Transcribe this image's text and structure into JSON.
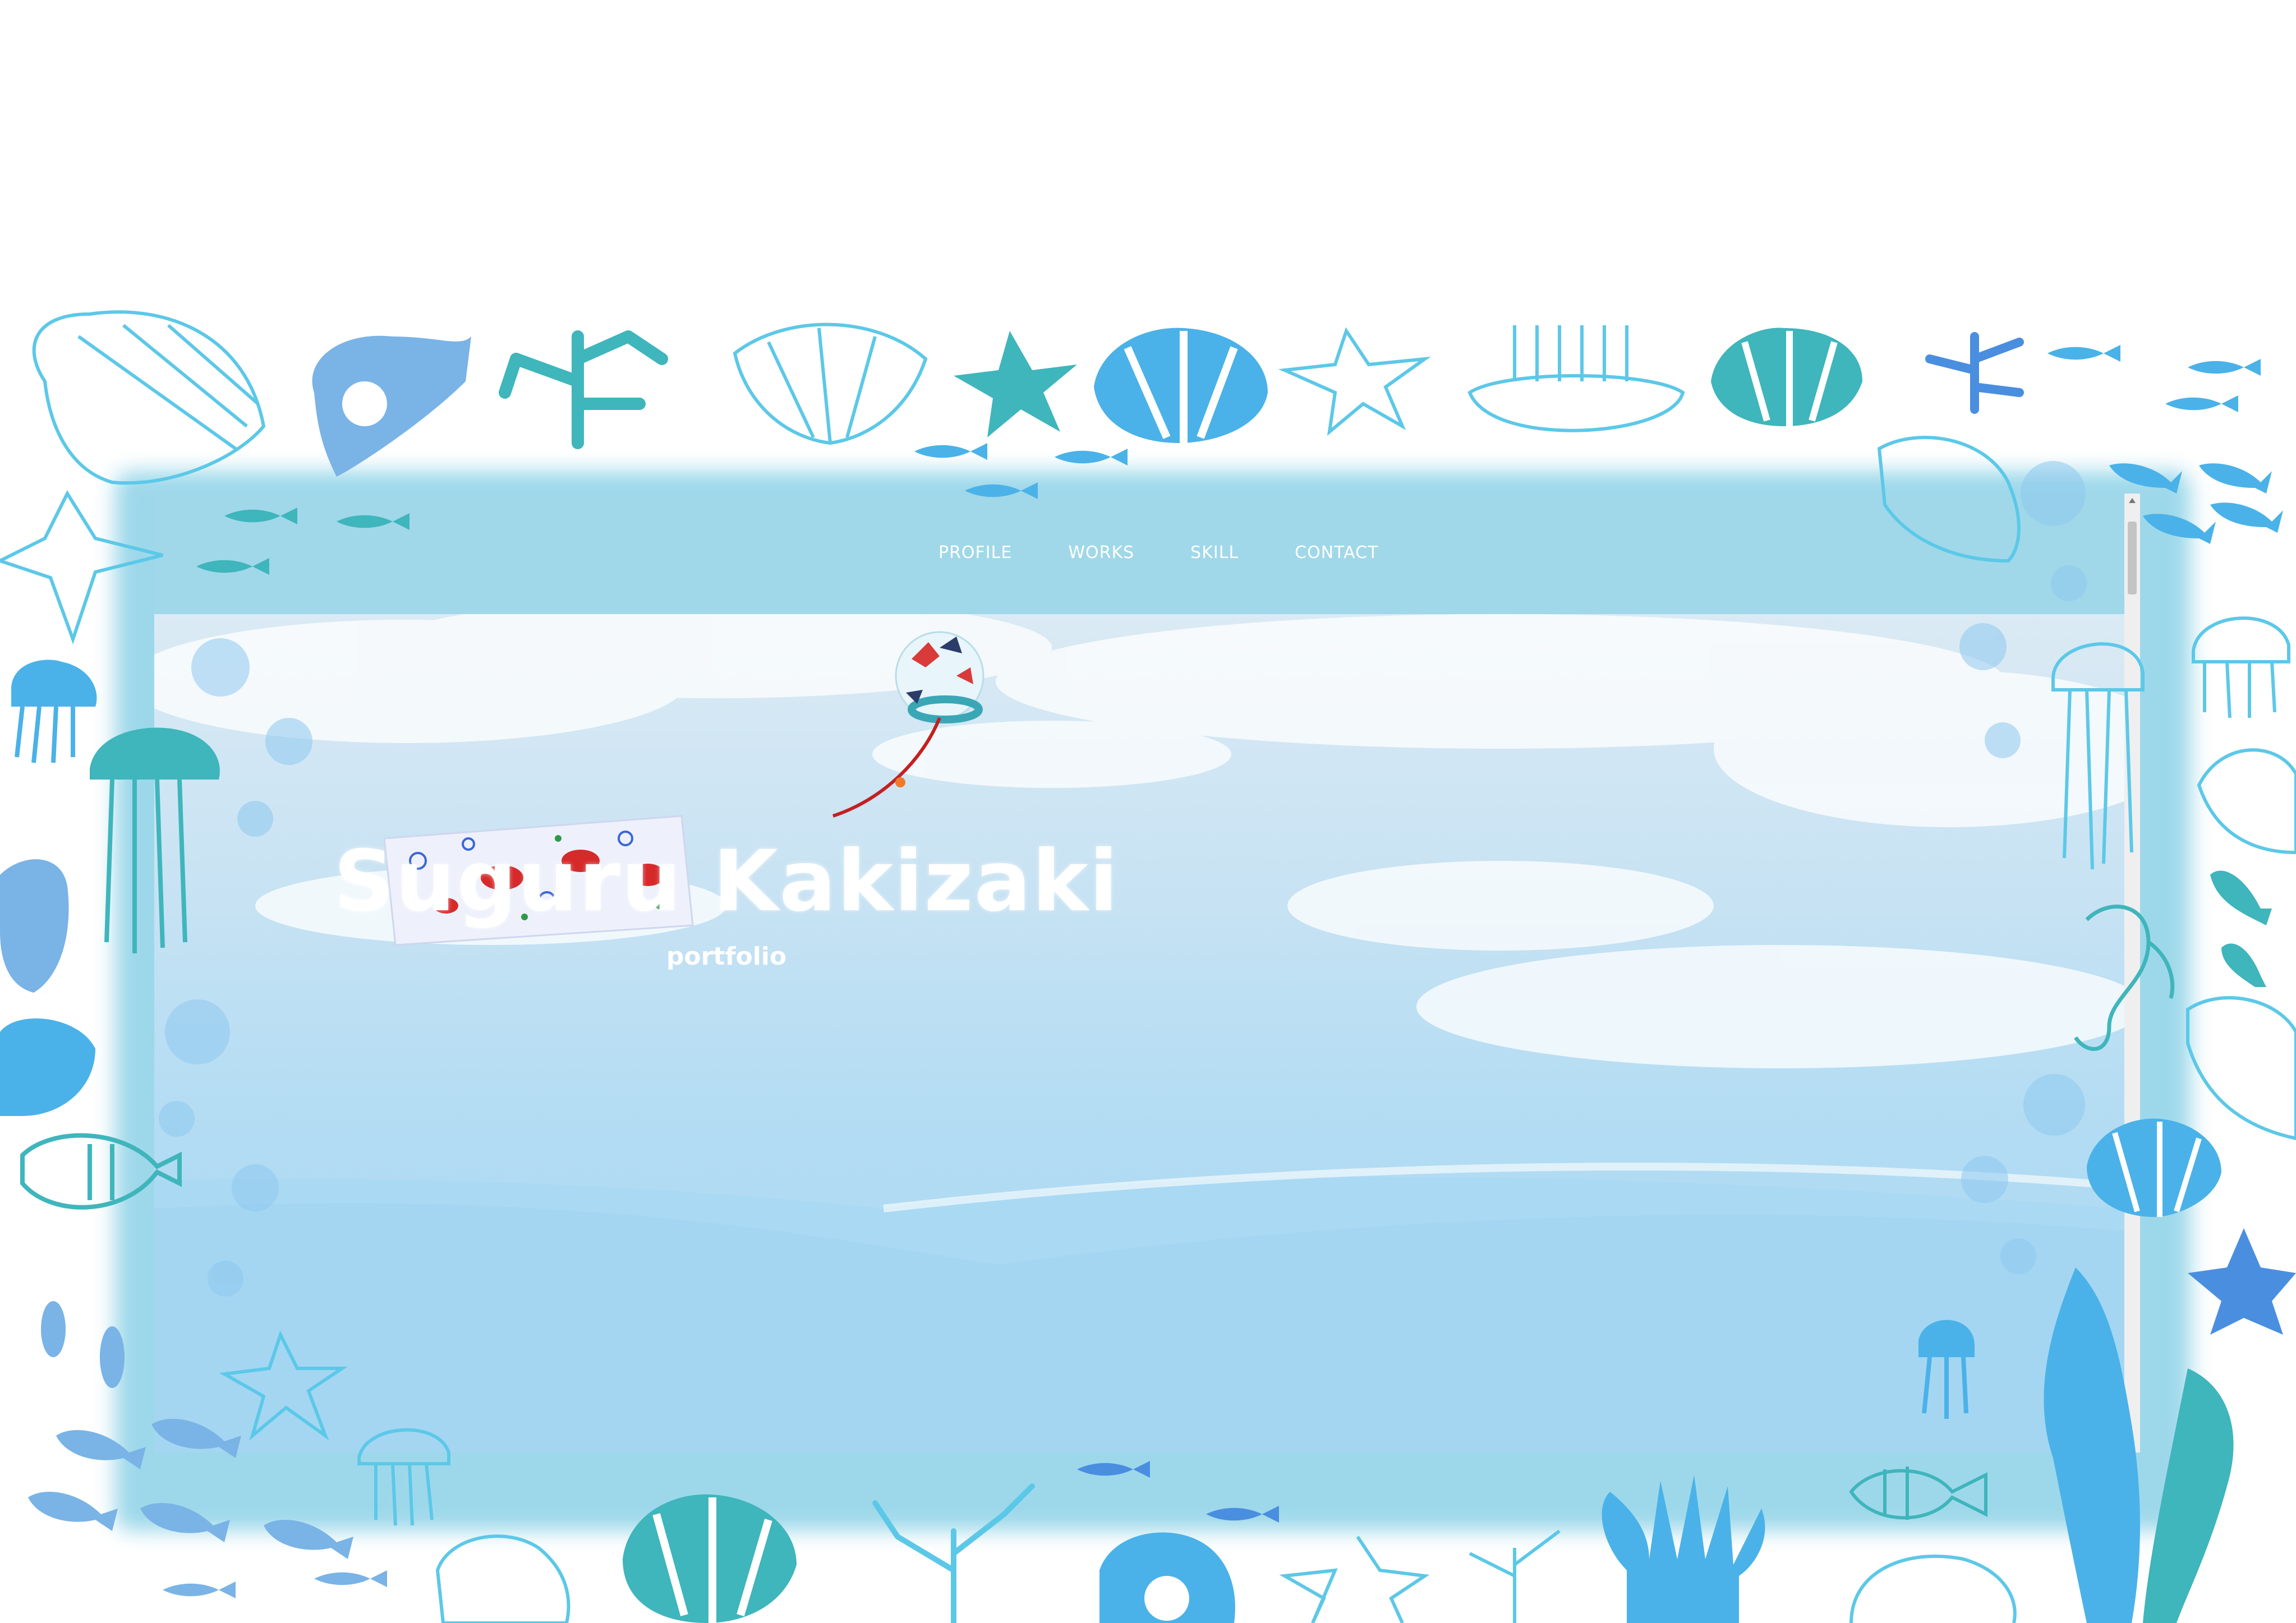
{
  "nav": {
    "items": [
      {
        "label": "PROFILE"
      },
      {
        "label": "WORKS"
      },
      {
        "label": "SKILL"
      },
      {
        "label": "CONTACT"
      }
    ]
  },
  "hero": {
    "title": "Suguru Kakizaki",
    "subtitle": "portfolio"
  },
  "colors": {
    "frame": "#9dd8ea",
    "nav_background": "#a0d8e9",
    "sea_icons": "#5cc8e8",
    "sea_icons_dark": "#3db1c9",
    "sky_top": "#dbeaf4",
    "sky_bottom": "#a8d8f2"
  },
  "icons": [
    "shell-icon",
    "coral-icon",
    "starfish-icon",
    "fish-icon",
    "jellyfish-icon",
    "seahorse-icon",
    "seaweed-icon",
    "bubble-icon",
    "wind-chime-icon",
    "goldfish-icon"
  ]
}
